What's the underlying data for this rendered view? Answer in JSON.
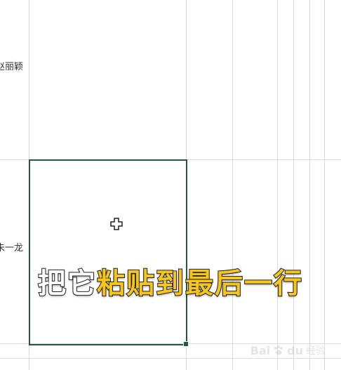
{
  "sheet": {
    "cells": [
      {
        "text": "赵丽颖"
      },
      {
        "text": "朱一龙"
      }
    ]
  },
  "caption": {
    "plain": "把它",
    "highlight": "粘贴到最后一行",
    "highlight_color": "#f6c51b"
  },
  "watermark": {
    "brand": "Bai",
    "paw": "du",
    "suffix": "经验"
  },
  "selection_color": "#1f5a3a"
}
